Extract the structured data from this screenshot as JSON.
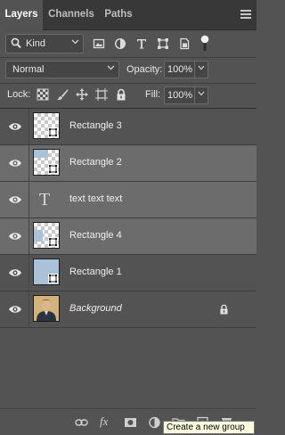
{
  "tabs": [
    {
      "label": "Layers",
      "active": true
    },
    {
      "label": "Channels",
      "active": false
    },
    {
      "label": "Paths",
      "active": false
    }
  ],
  "filter": {
    "kind_label": "Kind"
  },
  "blend": {
    "mode": "Normal",
    "opacity_label": "Opacity:",
    "opacity_value": "100%"
  },
  "lock": {
    "label": "Lock:",
    "fill_label": "Fill:",
    "fill_value": "100%"
  },
  "layers": [
    {
      "name": "Rectangle 3",
      "type": "shape",
      "selected": false
    },
    {
      "name": "Rectangle 2",
      "type": "shape",
      "selected": true
    },
    {
      "name": "text text text",
      "type": "text",
      "selected": true
    },
    {
      "name": "Rectangle 4",
      "type": "shape",
      "selected": true
    },
    {
      "name": "Rectangle 1",
      "type": "shape",
      "selected": false
    },
    {
      "name": "Background",
      "type": "image",
      "selected": false,
      "locked": true
    }
  ],
  "text_layer_glyph": "T",
  "bottom_bar": {
    "fx_label": "fx"
  },
  "tooltip": "Create a new group",
  "colors": {
    "panel": "#535353",
    "selected_row": "#6c6c6c",
    "shape_fill": "#a9c2d8",
    "tab_bar": "#383838"
  }
}
